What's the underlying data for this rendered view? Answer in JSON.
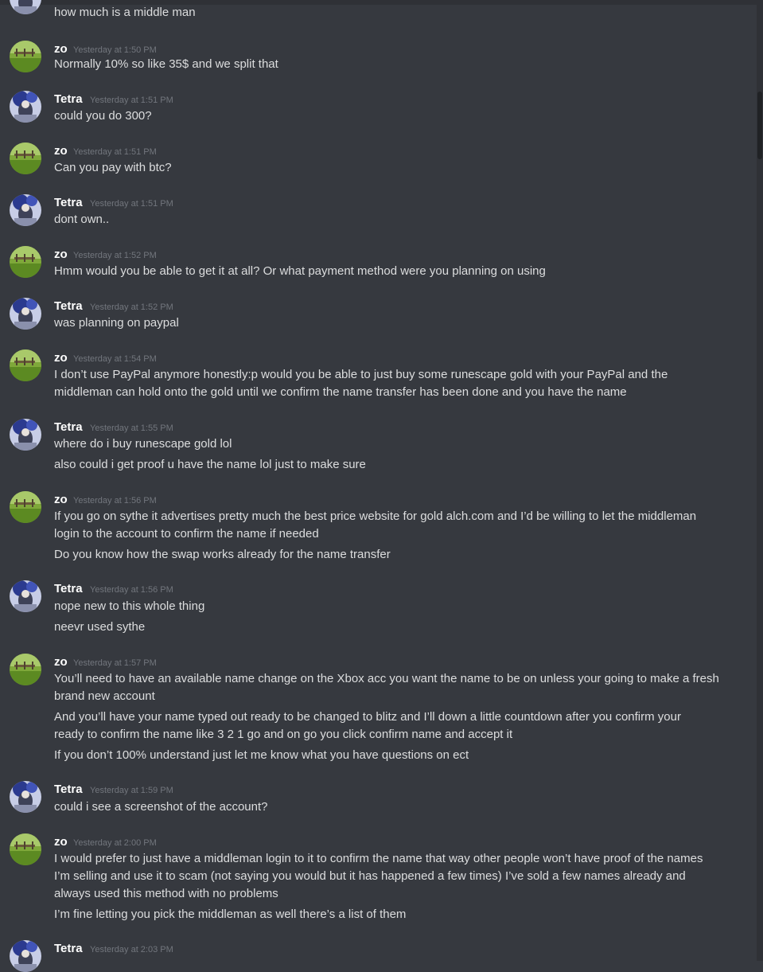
{
  "colors": {
    "background": "#36393f",
    "author": "#ffffff",
    "text": "#dcddde",
    "timestamp": "#72767d"
  },
  "avatars": {
    "zo": "green-field-avatar",
    "Tetra": "blue-character-avatar"
  },
  "messages": [
    {
      "author": "",
      "time": "",
      "lines": [
        "how much is a middle man"
      ]
    },
    {
      "author": "zo",
      "time": "Yesterday at 1:50 PM",
      "lines": [
        "Normally 10% so like 35$ and we split that"
      ]
    },
    {
      "author": "Tetra",
      "time": "Yesterday at 1:51 PM",
      "lines": [
        "could you do 300?"
      ]
    },
    {
      "author": "zo",
      "time": "Yesterday at 1:51 PM",
      "lines": [
        "Can you pay with btc?"
      ]
    },
    {
      "author": "Tetra",
      "time": "Yesterday at 1:51 PM",
      "lines": [
        "dont own.."
      ]
    },
    {
      "author": "zo",
      "time": "Yesterday at 1:52 PM",
      "lines": [
        "Hmm would you be able to get it at all? Or what payment method were you planning on using"
      ]
    },
    {
      "author": "Tetra",
      "time": "Yesterday at 1:52 PM",
      "lines": [
        "was planning on paypal"
      ]
    },
    {
      "author": "zo",
      "time": "Yesterday at 1:54 PM",
      "lines": [
        "I don’t use PayPal anymore honestly:p would you be able to just buy some runescape gold with your PayPal and the",
        "middleman can hold onto the gold until we confirm the name transfer has been done and you have the name"
      ]
    },
    {
      "author": "Tetra",
      "time": "Yesterday at 1:55 PM",
      "lines": [
        "where do i buy runescape gold lol",
        "also could i get proof u have the name lol just to make sure"
      ]
    },
    {
      "author": "zo",
      "time": "Yesterday at 1:56 PM",
      "lines": [
        "If you go on sythe it advertises pretty much the best price website for gold alch.com and I’d be willing to let the middleman",
        "login to the account to confirm the name if needed",
        "Do you know how the swap works already for the name transfer"
      ]
    },
    {
      "author": "Tetra",
      "time": "Yesterday at 1:56 PM",
      "lines": [
        "nope new to this whole thing",
        "neevr used sythe"
      ]
    },
    {
      "author": "zo",
      "time": "Yesterday at 1:57 PM",
      "lines": [
        "You’ll need to have an available name change on the Xbox acc you want the name to be on unless your going to make a fresh",
        "brand new account",
        "And you’ll have your name typed out ready to be changed to blitz and I’ll down a little countdown after you confirm your",
        "ready to confirm the name like 3 2 1 go and on go you click confirm name and accept it",
        "If you don’t  100% understand just let me know what you have questions on ect"
      ]
    },
    {
      "author": "Tetra",
      "time": "Yesterday at 1:59 PM",
      "lines": [
        "could i see a screenshot of the account?"
      ]
    },
    {
      "author": "zo",
      "time": "Yesterday at 2:00 PM",
      "lines": [
        "I would prefer to just have a middleman login to it to confirm the name that way other people won’t have proof of the names",
        "I’m selling and use it to scam (not saying you would but it has happened a few times) I’ve sold a few names already and",
        "always used this method with no problems",
        "I’m fine letting you pick the middleman as well there’s a list of them"
      ]
    },
    {
      "author": "Tetra",
      "time": "Yesterday at 2:03 PM",
      "lines": []
    }
  ]
}
